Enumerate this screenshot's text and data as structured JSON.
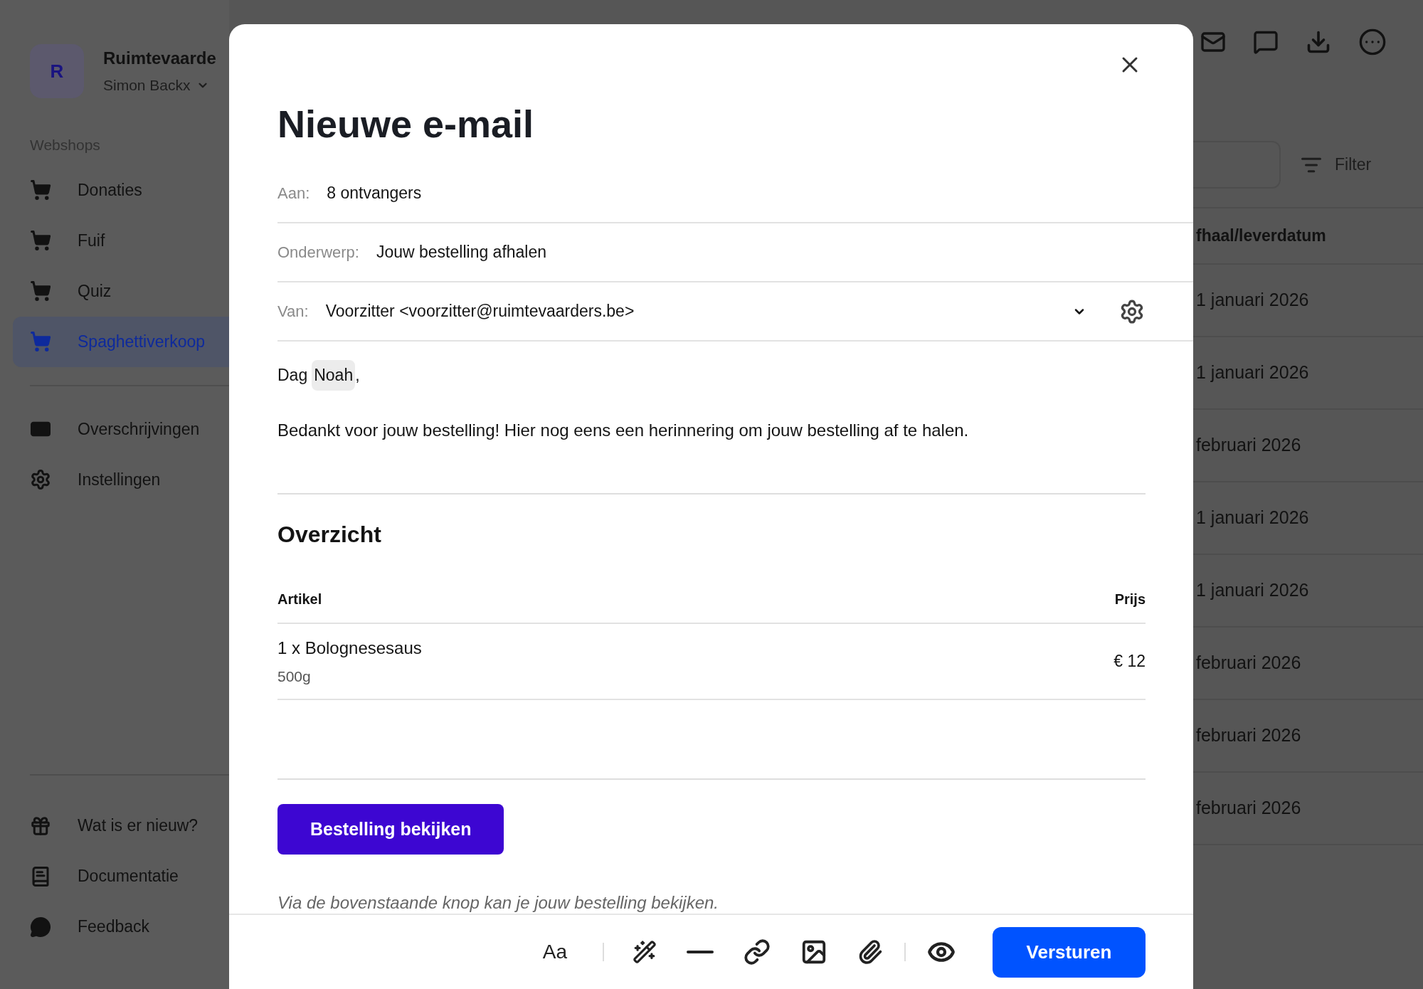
{
  "sidebar": {
    "org": {
      "initial": "R",
      "name": "Ruimtevaarde",
      "user": "Simon Backx"
    },
    "section_title": "Webshops",
    "webshops": [
      {
        "label": "Donaties",
        "selected": false
      },
      {
        "label": "Fuif",
        "selected": false
      },
      {
        "label": "Quiz",
        "selected": false
      },
      {
        "label": "Spaghettiverkoop",
        "selected": true
      }
    ],
    "admin_items": [
      {
        "label": "Overschrijvingen",
        "kind": "card"
      },
      {
        "label": "Instellingen",
        "kind": "gear"
      }
    ],
    "footer_items": [
      {
        "label": "Wat is er nieuw?",
        "kind": "gift"
      },
      {
        "label": "Documentatie",
        "kind": "book"
      },
      {
        "label": "Feedback",
        "kind": "chat"
      }
    ]
  },
  "filter": {
    "label": "Filter"
  },
  "table": {
    "columns": [
      "fhaal/leverdatum"
    ],
    "rows": [
      [
        "1 januari 2026"
      ],
      [
        "1 januari 2026"
      ],
      [
        "februari 2026"
      ],
      [
        "1 januari 2026"
      ],
      [
        "1 januari 2026"
      ],
      [
        "februari 2026"
      ],
      [
        "februari 2026"
      ],
      [
        "februari 2026"
      ]
    ]
  },
  "dialog": {
    "title": "Nieuwe e-mail",
    "fields": [
      {
        "label": "Aan:",
        "value": "8 ontvangers",
        "kind": "text"
      },
      {
        "label": "Onderwerp:",
        "value": "Jouw bestelling afhalen",
        "kind": "input"
      },
      {
        "label": "Van:",
        "value": "Voorzitter <voorzitter@ruimtevaarders.be>",
        "kind": "select"
      }
    ],
    "greeting": {
      "prefix": "Dag",
      "variable": "Noah",
      "suffix": ","
    },
    "paragraph": "Bedankt voor jouw bestelling! Hier nog eens een herinnering om jouw bestelling af te halen.",
    "overview": {
      "title": "Overzicht",
      "columns": [
        "Artikel",
        "Prijs"
      ],
      "items": [
        {
          "name": "1 x Bolognesesaus",
          "description": "500g",
          "price": "€ 12"
        }
      ]
    },
    "action_button": "Bestelling bekijken",
    "note": "Via de bovenstaande knop kan je jouw bestelling bekijken.",
    "format_label": "Aa",
    "send_button": "Versturen"
  }
}
